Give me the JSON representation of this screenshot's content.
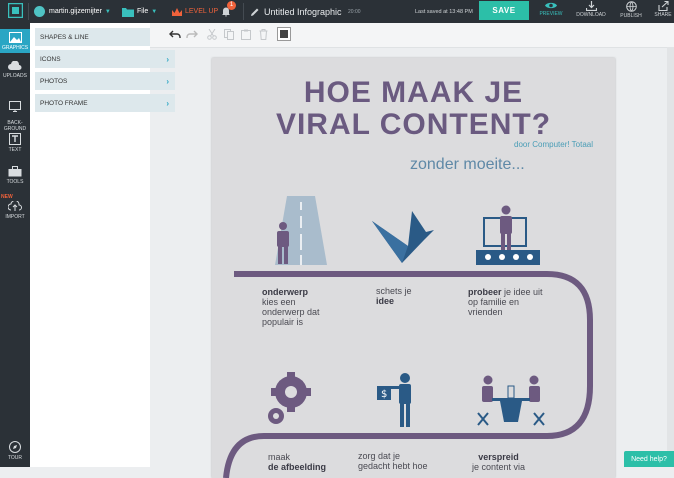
{
  "topbar": {
    "username": "martin.gijzemijter",
    "file_menu": "File",
    "level_up": "LEVEL UP",
    "notification_count": "1",
    "document_title": "Untitled Infographic",
    "time_small": "20:00",
    "last_saved": "Last saved at 13:48 PM",
    "save_label": "SAVE",
    "preview_label": "PREVIEW",
    "download_label": "DOWNLOAD",
    "publish_label": "PUBLISH",
    "share_label": "SHARE"
  },
  "rail": {
    "graphics": "GRAPHICS",
    "uploads": "UPLOADS",
    "background": "BACK-\nGROUND",
    "text": "TEXT",
    "tools": "TOOLS",
    "new_badge": "NEW",
    "import": "IMPORT",
    "tour": "TOUR"
  },
  "categories": [
    {
      "label": "SHAPES & LINE"
    },
    {
      "label": "ICONS"
    },
    {
      "label": "PHOTOS"
    },
    {
      "label": "PHOTO FRAME"
    }
  ],
  "infographic": {
    "title_line1": "HOE MAAK JE",
    "title_line2": "VIRAL CONTENT?",
    "byline": "door Computer! Totaal",
    "subtitle": "zonder moeite...",
    "step1_bold": "onderwerp",
    "step1_text": "kies een\nonderwerp dat\npopulair is",
    "step2_text": "schets je",
    "step2_bold": "idee",
    "step3_bold": "probeer",
    "step3_text": " je idee uit\nop familie en\nvrienden",
    "step4_text": "maak",
    "step4_bold": "de afbeelding",
    "step5_text": "zorg dat je\ngedacht hebt hoe",
    "step6_bold": "verspreid",
    "step6_text": "je content via"
  },
  "help_label": "Need help?",
  "colors": {
    "accent": "#2cbfa8",
    "rail_active": "#2aa6c4",
    "title_purple": "#6a5a80",
    "road_purple": "#6d5a80",
    "icon_blue": "#2a5a86"
  }
}
